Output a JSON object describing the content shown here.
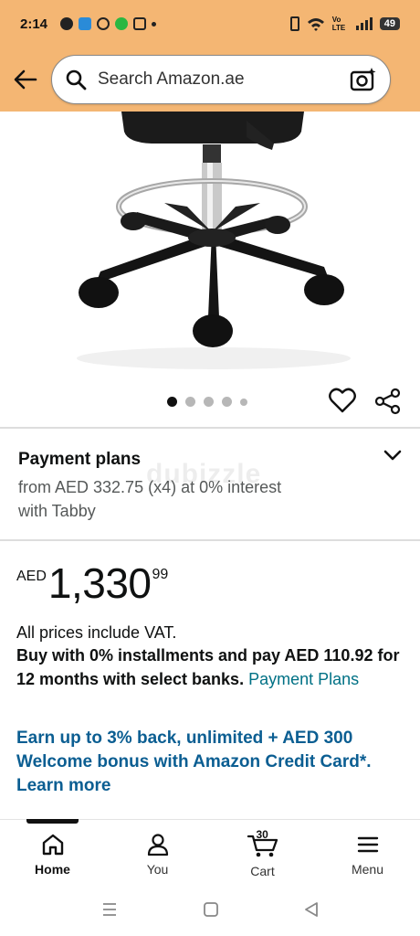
{
  "status_bar": {
    "time": "2:14",
    "signal_text": "Vo LTE",
    "battery": "49"
  },
  "search": {
    "placeholder": "Search Amazon.ae"
  },
  "gallery": {
    "dot_count": 5,
    "active_index": 0
  },
  "watermark": "dubizzle",
  "payment_plans": {
    "title": "Payment plans",
    "description": "from AED 332.75 (x4) at 0% interest with Tabby"
  },
  "price": {
    "currency": "AED",
    "whole": "1,330",
    "fraction": "99"
  },
  "vat_note": "All prices include VAT.",
  "installments": {
    "text": "Buy with 0% installments and pay AED 110.92 for 12 months with select banks.",
    "link": "Payment Plans"
  },
  "promo": {
    "text": "Earn up to 3% back, unlimited + AED 300 Welcome bonus with Amazon Credit Card*.",
    "link": "Learn more"
  },
  "bottom_nav": {
    "items": [
      {
        "label": "Home",
        "icon": "home-icon",
        "active": true
      },
      {
        "label": "You",
        "icon": "user-icon"
      },
      {
        "label": "Cart",
        "icon": "cart-icon"
      },
      {
        "label": "Menu",
        "icon": "menu-icon"
      }
    ],
    "cart_count": "30"
  },
  "colors": {
    "header_bg": "#f4b673",
    "link": "#007185",
    "promo": "#0b5e92"
  }
}
